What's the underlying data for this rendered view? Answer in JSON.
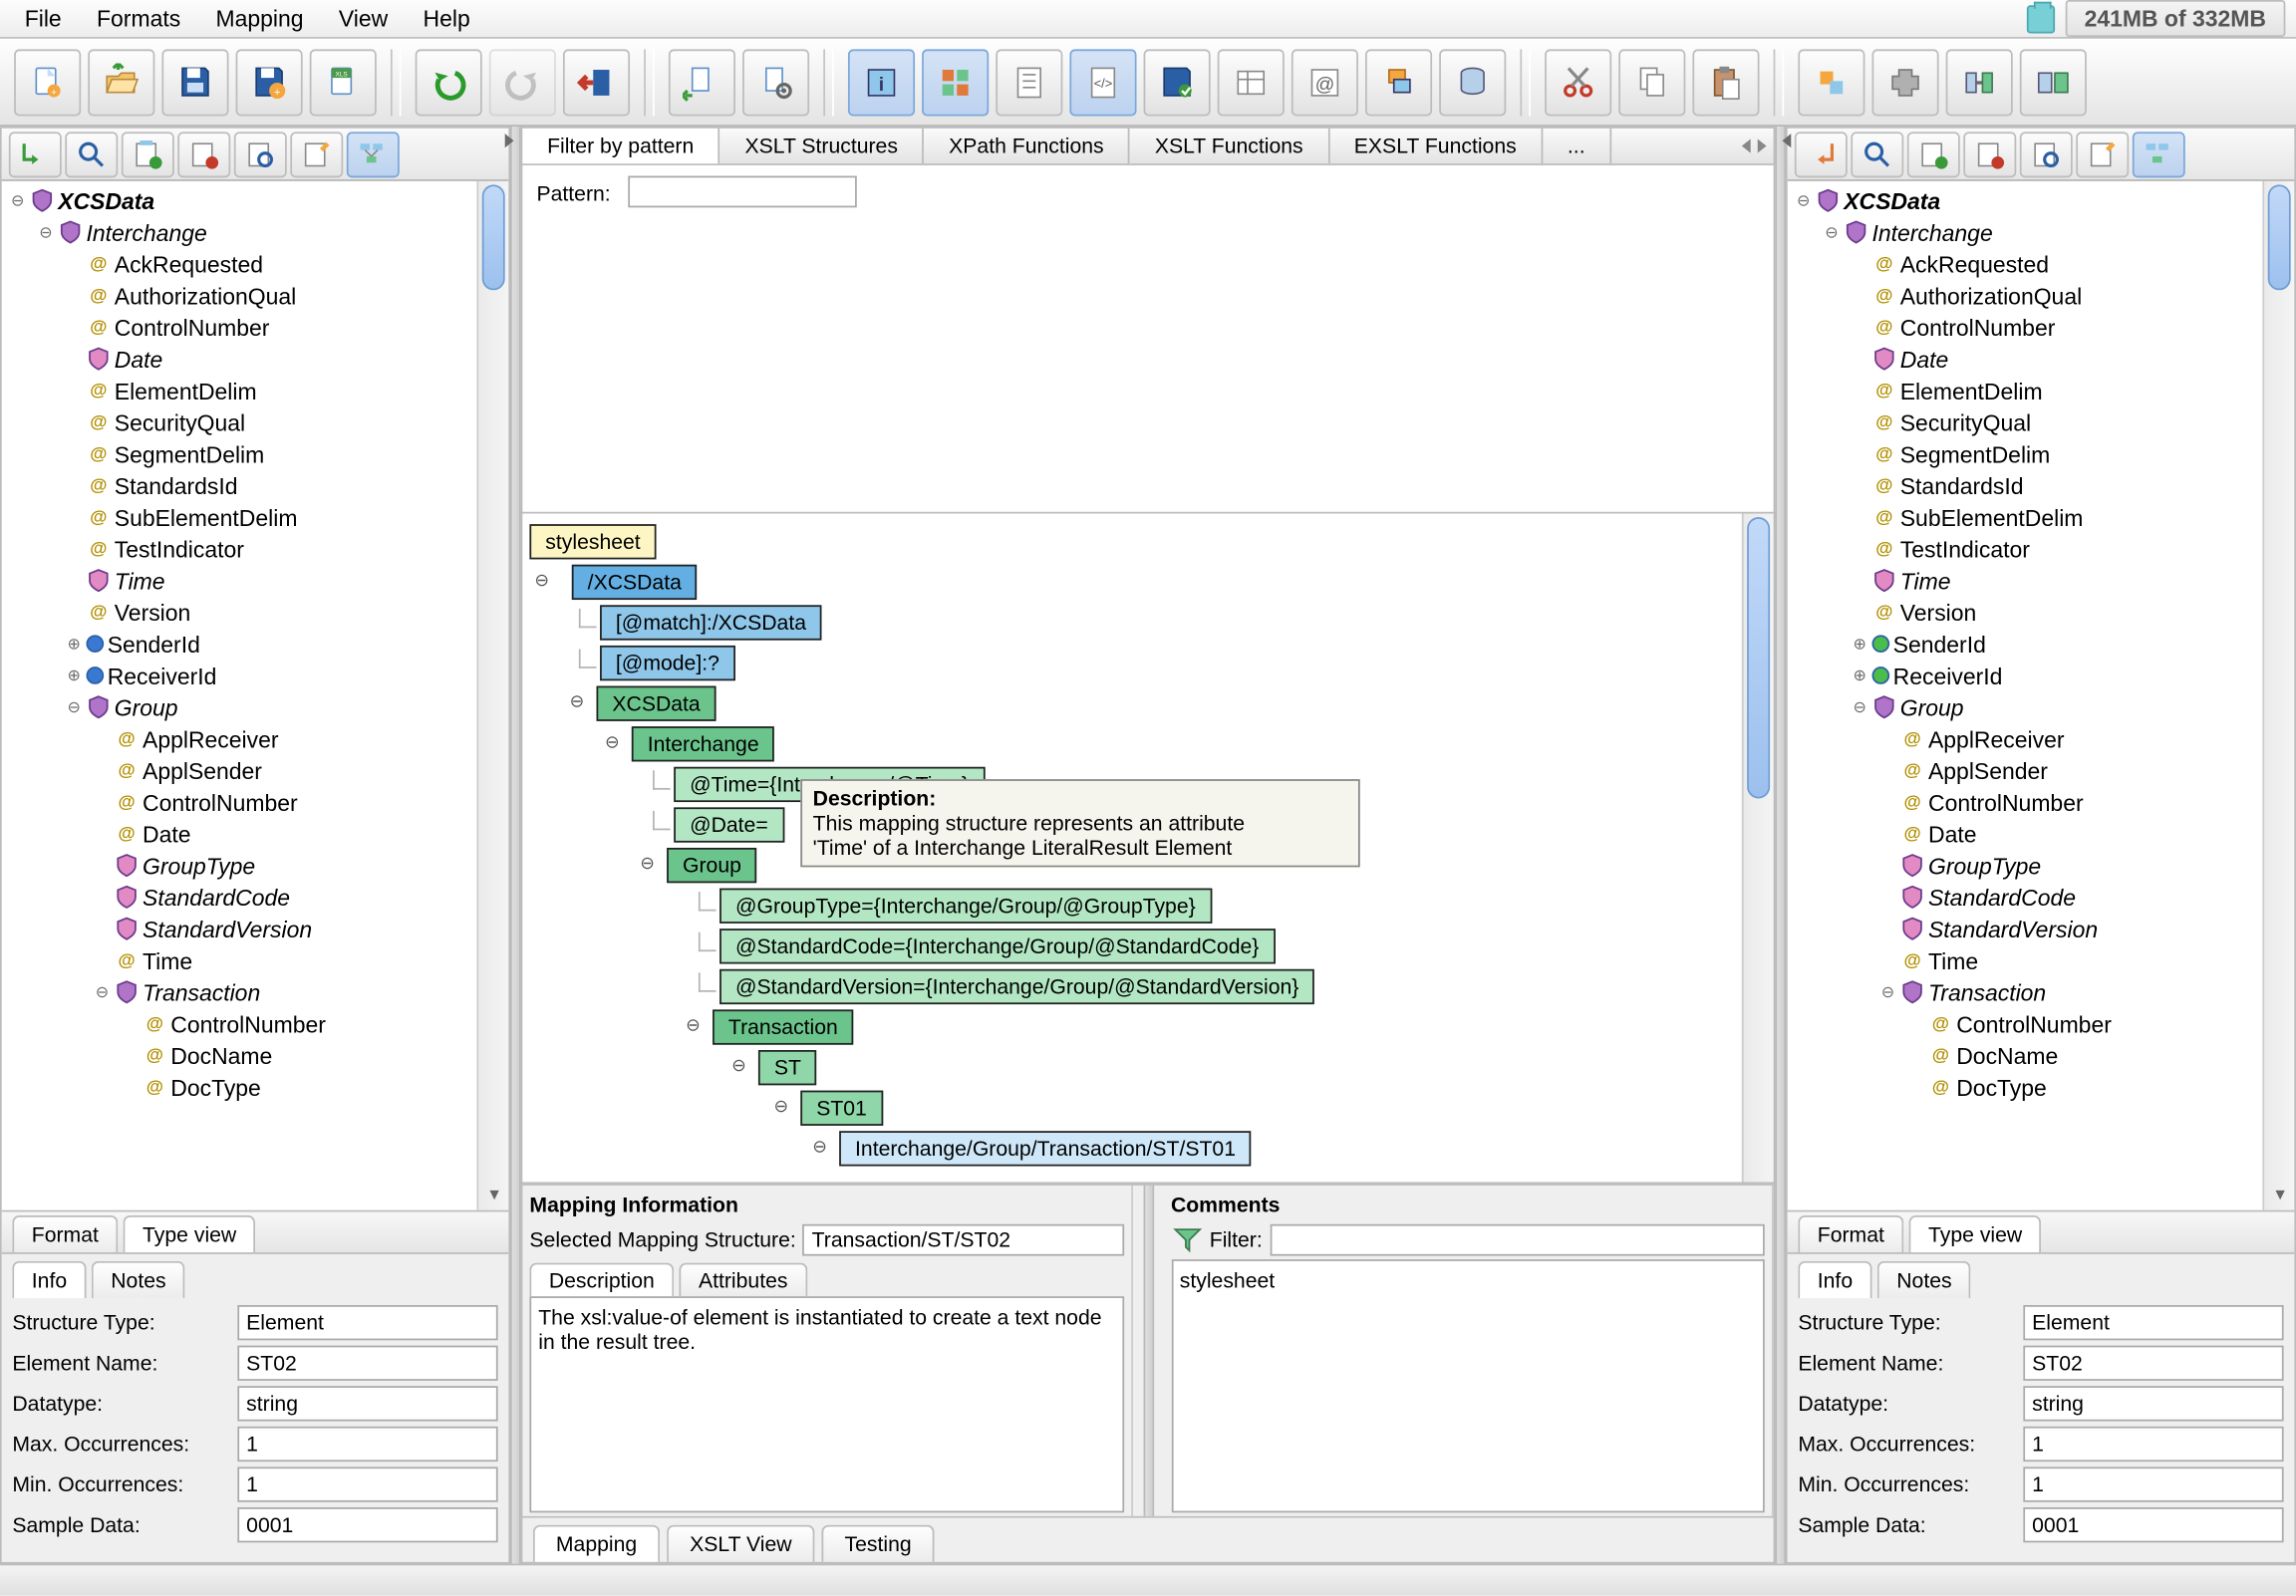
{
  "memory": "241MB of 332MB",
  "menu": [
    "File",
    "Formats",
    "Mapping",
    "View",
    "Help"
  ],
  "center_tabs": [
    "Filter by pattern",
    "XSLT Structures",
    "XPath Functions",
    "XSLT Functions",
    "EXSLT Functions",
    "..."
  ],
  "pattern_label": "Pattern:",
  "side_tabs": {
    "format": "Format",
    "typeview": "Type view"
  },
  "info_tabs": {
    "info": "Info",
    "notes": "Notes"
  },
  "info_left": {
    "structure_type_label": "Structure Type:",
    "structure_type": "Element",
    "element_name_label": "Element Name:",
    "element_name": "ST02",
    "datatype_label": "Datatype:",
    "datatype": "string",
    "max_label": "Max. Occurrences:",
    "max": "1",
    "min_label": "Min. Occurrences:",
    "min": "1",
    "sample_label": "Sample Data:",
    "sample": "0001"
  },
  "info_right": {
    "structure_type_label": "Structure Type:",
    "structure_type": "Element",
    "element_name_label": "Element Name:",
    "element_name": "ST02",
    "datatype_label": "Datatype:",
    "datatype": "string",
    "max_label": "Max. Occurrences:",
    "max": "1",
    "min_label": "Min. Occurrences:",
    "min": "1",
    "sample_label": "Sample Data:",
    "sample": "0001"
  },
  "tree": {
    "root": "XCSData",
    "interchange": "Interchange",
    "items1": [
      "AckRequested",
      "AuthorizationQual",
      "ControlNumber"
    ],
    "date": "Date",
    "items2": [
      "ElementDelim",
      "SecurityQual",
      "SegmentDelim",
      "StandardsId",
      "SubElementDelim",
      "TestIndicator"
    ],
    "time": "Time",
    "version": "Version",
    "sender": "SenderId",
    "receiver": "ReceiverId",
    "group": "Group",
    "group_items": [
      "ApplReceiver",
      "ApplSender",
      "ControlNumber",
      "Date"
    ],
    "grouptype": "GroupType",
    "stdcode": "StandardCode",
    "stdver": "StandardVersion",
    "group_time": "Time",
    "transaction": "Transaction",
    "tx_items": [
      "ControlNumber",
      "DocName",
      "DocType"
    ]
  },
  "mapping": {
    "stylesheet": "stylesheet",
    "xcs": " /XCSData",
    "match": "[@match]:/XCSData",
    "mode": "[@mode]:?",
    "xcs2": "XCSData",
    "interchange": "Interchange",
    "attr_time": "@Time={Interchange/@Time}",
    "attr_date": "@Date=",
    "group": "Group",
    "attr_gt": "@GroupType={Interchange/Group/@GroupType}",
    "attr_sc": "@StandardCode={Interchange/Group/@StandardCode}",
    "attr_sv": "@StandardVersion={Interchange/Group/@StandardVersion}",
    "transaction": "Transaction",
    "st": "ST",
    "st01": "ST01",
    "st01path": "Interchange/Group/Transaction/ST/ST01"
  },
  "tooltip": {
    "title": "Description:",
    "body1": "This mapping structure represents an attribute",
    "body2": "'Time' of a Interchange LiteralResult Element"
  },
  "mapinfo": {
    "heading": "Mapping Information",
    "sel_label": "Selected Mapping Structure:",
    "sel_value": "Transaction/ST/ST02",
    "tab_desc": "Description",
    "tab_attr": "Attributes",
    "desc": "The xsl:value-of element is instantiated to create a text node in the result tree."
  },
  "comments": {
    "heading": "Comments",
    "filter_label": "Filter:",
    "item": "stylesheet"
  },
  "bottom_tabs": {
    "mapping": "Mapping",
    "xsltview": "XSLT View",
    "testing": "Testing"
  }
}
